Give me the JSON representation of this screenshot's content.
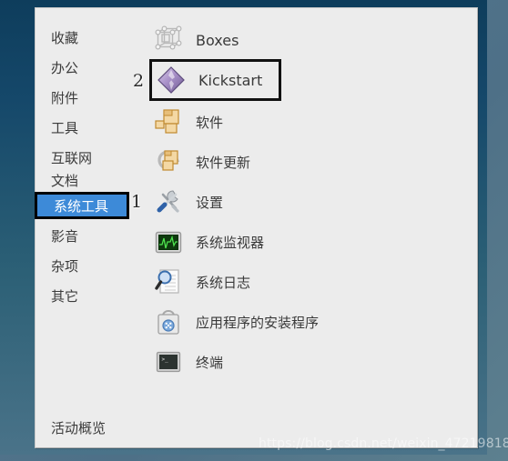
{
  "window": {
    "kind": "application-launcher-menu",
    "background_color": "#51748c",
    "panel_color": "#ececec",
    "frame_color": "#15486a"
  },
  "sidebar": {
    "selected_index": 6,
    "selected_bg": "#3d8ad8",
    "selected_text_color": "#ffffff",
    "items": [
      {
        "label": "收藏"
      },
      {
        "label": "办公"
      },
      {
        "label": "附件"
      },
      {
        "label": "工具"
      },
      {
        "label": "互联网"
      },
      {
        "label": "文档"
      },
      {
        "label": "系统工具"
      },
      {
        "label": "影音"
      },
      {
        "label": "杂项"
      },
      {
        "label": "其它"
      }
    ],
    "footer": {
      "label": "活动概览"
    }
  },
  "applist": {
    "highlighted_index": 1,
    "items": [
      {
        "label": "Boxes",
        "icon": "boxes-wireframe-cube-icon",
        "latin": true
      },
      {
        "label": "Kickstart",
        "icon": "kickstart-diamond-icon",
        "latin": true
      },
      {
        "label": "软件",
        "icon": "software-package-icon",
        "latin": false
      },
      {
        "label": "软件更新",
        "icon": "software-update-icon",
        "latin": false
      },
      {
        "label": "设置",
        "icon": "settings-tools-icon",
        "latin": false
      },
      {
        "label": "系统监视器",
        "icon": "system-monitor-icon",
        "latin": false
      },
      {
        "label": "系统日志",
        "icon": "system-log-icon",
        "latin": false
      },
      {
        "label": "应用程序的安装程序",
        "icon": "app-installer-bag-icon",
        "latin": false
      },
      {
        "label": "终端",
        "icon": "terminal-icon",
        "latin": false
      }
    ]
  },
  "annotations": [
    {
      "id": "marker-1",
      "label": "1"
    },
    {
      "id": "marker-2",
      "label": "2"
    }
  ],
  "watermark": {
    "text": "https://blog.csdn.net/weixin_47219818"
  }
}
